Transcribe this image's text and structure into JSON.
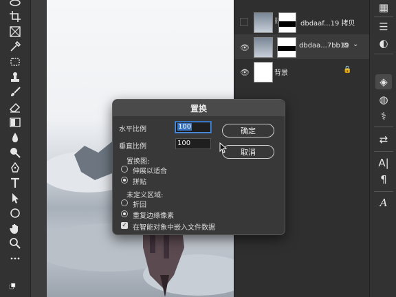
{
  "layers": [
    {
      "name": "dbdaaf...19 拷贝",
      "visible": false,
      "selected": false,
      "has_link": true
    },
    {
      "name": "dbdaa...7bb19",
      "visible": true,
      "selected": true,
      "has_link": false
    },
    {
      "name": "背景",
      "visible": true,
      "selected": false,
      "locked": true
    }
  ],
  "dialog": {
    "title": "置换",
    "h_scale_label": "水平比例",
    "h_scale_value": "100",
    "v_scale_label": "垂直比例",
    "v_scale_value": "100",
    "ok_label": "确定",
    "cancel_label": "取消",
    "displacement_map_label": "置换图:",
    "map_options": [
      "伸展以适合",
      "拼贴"
    ],
    "map_selected": "拼贴",
    "undefined_area_label": "未定义区域:",
    "area_options": [
      "折回",
      "重复边缘像素"
    ],
    "area_selected": "重复边缘像素",
    "embed_label": "在智能对象中嵌入文件数据",
    "embed_checked": true
  },
  "tool_icons": [
    "lasso-icon",
    "crop-icon",
    "frame-icon",
    "eyedropper-icon",
    "spot-healing-icon",
    "clone-stamp-icon",
    "brush-icon",
    "eraser-icon",
    "gradient-icon",
    "blur-icon",
    "dodge-icon",
    "pen-icon",
    "type-icon",
    "path-select-icon",
    "ellipse-icon",
    "hand-icon",
    "zoom-icon",
    "more-icon"
  ],
  "right_icons": [
    "libraries-icon",
    "adjustments-icon",
    "color-icon",
    "layers-icon",
    "channels-icon",
    "paths-icon",
    "properties-icon",
    "character-icon",
    "paragraph-icon",
    "glyphs-icon"
  ],
  "colors": {
    "accent": "#3a75c4",
    "panel": "#323232",
    "dialog": "#383838"
  }
}
